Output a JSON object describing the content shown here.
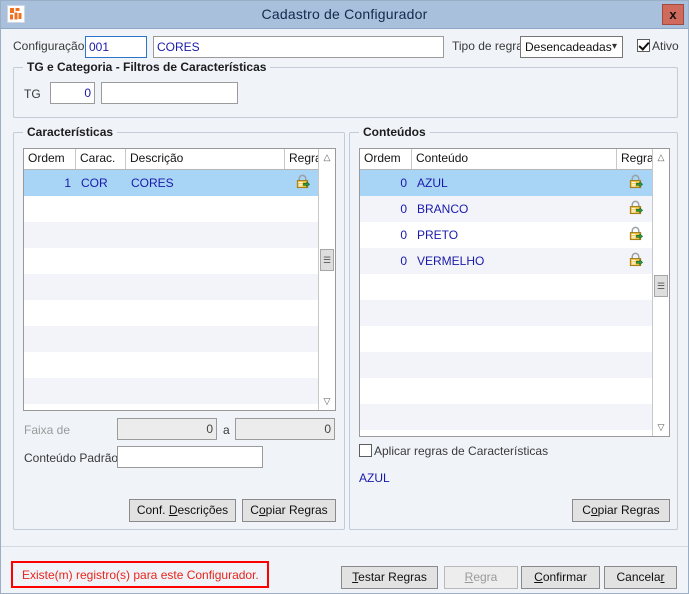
{
  "window": {
    "title": "Cadastro de Configurador",
    "app_icon": "app-icon",
    "close_label": "x"
  },
  "header": {
    "config_label": "Configuração",
    "config_code": "001",
    "config_name": "CORES",
    "rule_type_label": "Tipo de regra",
    "rule_type_value": "Desencadeadas",
    "rule_type_options": [
      "Desencadeadas"
    ],
    "active_label": "Ativo",
    "active_checked": true
  },
  "filters_group": {
    "title": "TG e Categoria - Filtros de Características",
    "tg_label": "TG",
    "tg_value": "0",
    "tg_name_value": ""
  },
  "caracteristicas": {
    "title": "Características",
    "columns": [
      "Ordem",
      "Carac.",
      "Descrição",
      "Regra"
    ],
    "rows": [
      {
        "ordem": "1",
        "carac": "COR",
        "descricao": "CORES",
        "regra_icon": "lock-rule-icon",
        "selected": true
      }
    ],
    "empty_rows": 8,
    "faixa_label": "Faixa de",
    "faixa_de": "0",
    "faixa_a_label": "a",
    "faixa_ate": "0",
    "conteudo_padrao_label": "Conteúdo Padrão",
    "conteudo_padrao_value": "",
    "btn_conf_descricoes": "Conf. Descrições",
    "btn_conf_descricoes_accel": "D",
    "btn_copiar_regras": "Copiar Regras",
    "btn_copiar_regras_accel": "o"
  },
  "conteudos": {
    "title": "Conteúdos",
    "columns": [
      "Ordem",
      "Conteúdo",
      "Regra"
    ],
    "rows": [
      {
        "ordem": "0",
        "conteudo": "AZUL",
        "regra_icon": "lock-rule-icon",
        "selected": true
      },
      {
        "ordem": "0",
        "conteudo": "BRANCO",
        "regra_icon": "lock-rule-icon",
        "selected": false
      },
      {
        "ordem": "0",
        "conteudo": "PRETO",
        "regra_icon": "lock-rule-icon",
        "selected": false
      },
      {
        "ordem": "0",
        "conteudo": "VERMELHO",
        "regra_icon": "lock-rule-icon",
        "selected": false
      }
    ],
    "empty_rows": 7,
    "aplicar_label": "Aplicar regras de Características",
    "aplicar_checked": false,
    "selected_text": "AZUL",
    "btn_copiar_regras": "Copiar Regras",
    "btn_copiar_regras_accel": "o"
  },
  "footer": {
    "message": "Existe(m) registro(s) para este Configurador.",
    "btn_testar_regras": "Testar Regras",
    "btn_testar_regras_accel": "T",
    "btn_regra": "Regra",
    "btn_regra_accel": "R",
    "btn_regra_disabled": true,
    "btn_confirmar": "Confirmar",
    "btn_confirmar_accel": "C",
    "btn_cancelar": "Cancelar",
    "btn_cancelar_accel": "r"
  },
  "colors": {
    "titlebar": "#a8c0dc",
    "selection": "#a8d4f5",
    "field_text": "#1a1aa8",
    "error": "#e8261c",
    "close_button": "#cf6a5c"
  }
}
